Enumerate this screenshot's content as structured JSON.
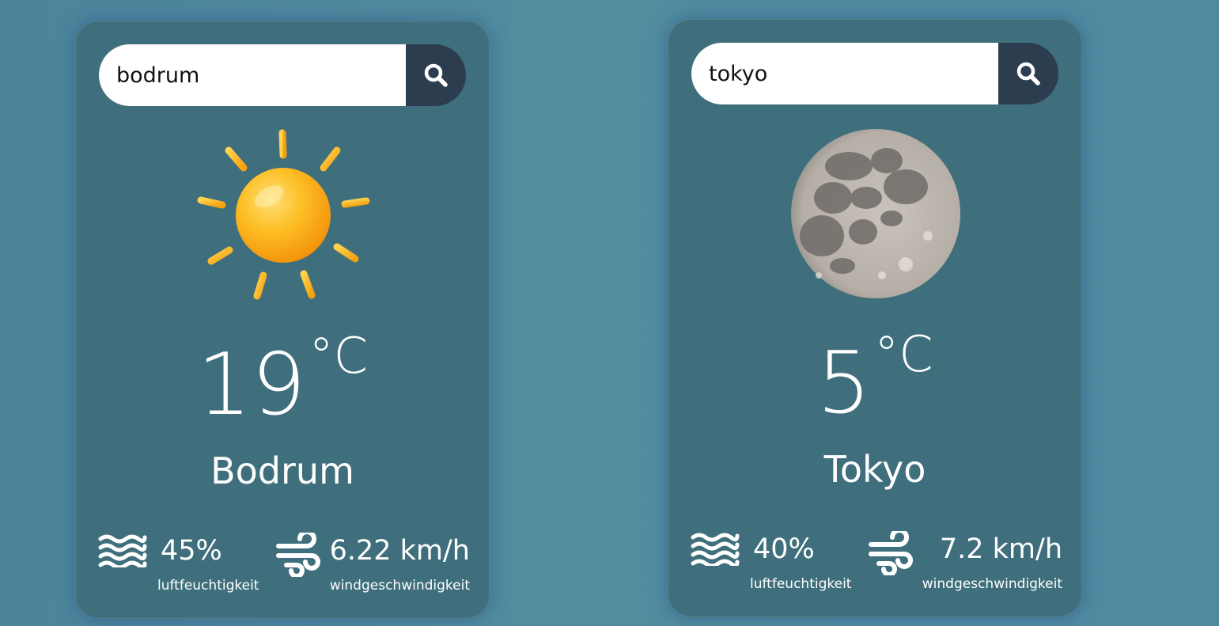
{
  "cards": [
    {
      "search": {
        "value": "bodrum",
        "icon": "search-icon"
      },
      "weather_icon": "sun-icon",
      "temperature": {
        "value": "19",
        "unit": "°C"
      },
      "city": "Bodrum",
      "humidity": {
        "value": "45%",
        "label": "luftfeuchtigkeit",
        "icon": "humidity-waves-icon"
      },
      "wind": {
        "value": "6.22 km/h",
        "label": "windgeschwindigkeit",
        "icon": "wind-icon"
      }
    },
    {
      "search": {
        "value": "tokyo",
        "icon": "search-icon"
      },
      "weather_icon": "moon-icon",
      "temperature": {
        "value": "5",
        "unit": "°C"
      },
      "city": "Tokyo",
      "humidity": {
        "value": "40%",
        "label": "luftfeuchtigkeit",
        "icon": "humidity-waves-icon"
      },
      "wind": {
        "value": "7.2 km/h",
        "label": "windgeschwindigkeit",
        "icon": "wind-icon"
      }
    }
  ],
  "colors": {
    "background": "#4f8aa0",
    "card": "#3f6f7c",
    "search_button": "#2d3d50",
    "text": "#ffffff",
    "sun": "#fbb715"
  }
}
